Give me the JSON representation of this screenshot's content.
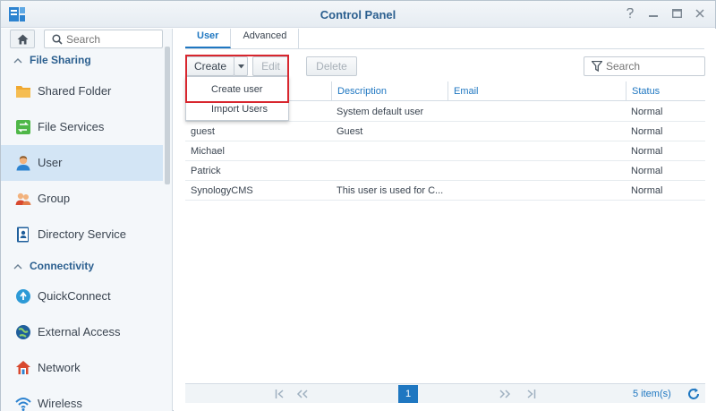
{
  "window": {
    "title": "Control Panel"
  },
  "sidebar": {
    "search_placeholder": "Search",
    "sections": [
      {
        "label": "File Sharing"
      },
      {
        "label": "Connectivity"
      }
    ],
    "items": [
      {
        "label": "Shared Folder",
        "icon": "shared-folder-icon"
      },
      {
        "label": "File Services",
        "icon": "file-services-icon"
      },
      {
        "label": "User",
        "icon": "user-icon",
        "active": true
      },
      {
        "label": "Group",
        "icon": "group-icon"
      },
      {
        "label": "Directory Service",
        "icon": "directory-service-icon"
      },
      {
        "label": "QuickConnect",
        "icon": "quickconnect-icon"
      },
      {
        "label": "External Access",
        "icon": "external-access-icon"
      },
      {
        "label": "Network",
        "icon": "network-icon"
      },
      {
        "label": "Wireless",
        "icon": "wireless-icon"
      }
    ]
  },
  "tabs": [
    {
      "label": "User",
      "active": true
    },
    {
      "label": "Advanced"
    }
  ],
  "toolbar": {
    "create_label": "Create",
    "edit_label": "Edit",
    "delete_label": "Delete",
    "search_placeholder": "Search"
  },
  "create_menu": {
    "items": [
      {
        "label": "Create user"
      },
      {
        "label": "Import Users"
      }
    ]
  },
  "table": {
    "columns": [
      "Description",
      "Email",
      "Status"
    ],
    "rows": [
      {
        "name": "",
        "description": "System default user",
        "email": "",
        "status": "Normal"
      },
      {
        "name": "guest",
        "description": "Guest",
        "email": "",
        "status": "Normal"
      },
      {
        "name": "Michael",
        "description": "",
        "email": "",
        "status": "Normal"
      },
      {
        "name": "Patrick",
        "description": "",
        "email": "",
        "status": "Normal"
      },
      {
        "name": "SynologyCMS",
        "description": "This user is used for C...",
        "email": "",
        "status": "Normal"
      }
    ]
  },
  "pagination": {
    "current_page": "1",
    "items_count": "5 item(s)"
  },
  "colors": {
    "accent": "#1f77c1",
    "highlight": "#d8262e",
    "active_item_bg": "#d3e5f5"
  }
}
